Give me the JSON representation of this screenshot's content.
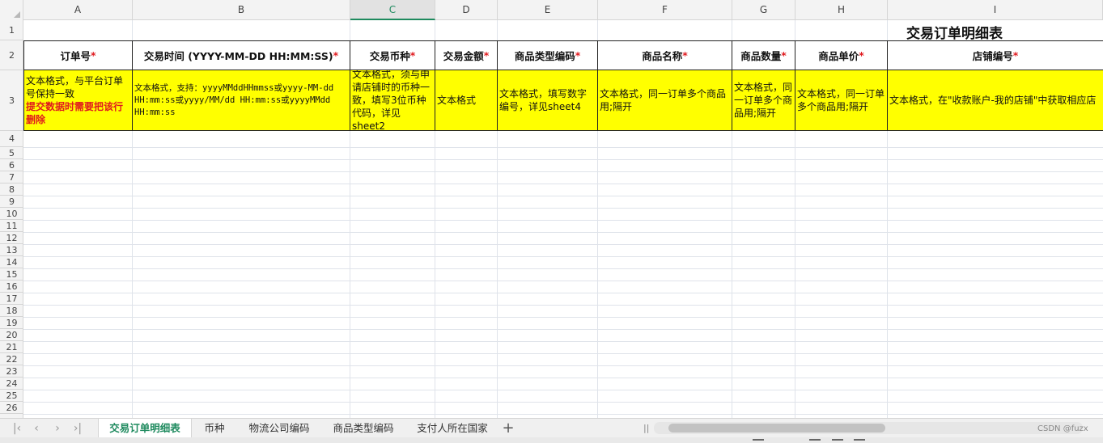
{
  "column_headers": [
    "A",
    "B",
    "C",
    "D",
    "E",
    "F",
    "G",
    "H",
    "I"
  ],
  "row_numbers": [
    "1",
    "2",
    "3",
    "4",
    "5",
    "6",
    "7",
    "8",
    "9",
    "10",
    "11",
    "12",
    "13",
    "14",
    "15",
    "16",
    "17",
    "18",
    "19",
    "20",
    "21",
    "22",
    "23",
    "24",
    "25",
    "26"
  ],
  "sheet": {
    "title": "交易订单明细表",
    "headers": [
      {
        "label": "订单号",
        "star": "*"
      },
      {
        "label": "交易时间 (YYYY-MM-DD HH:MM:SS)",
        "star": " *"
      },
      {
        "label": "交易币种",
        "star": "*"
      },
      {
        "label": "交易金额",
        "star": "*"
      },
      {
        "label": "商品类型编码",
        "star": "*"
      },
      {
        "label": "商品名称",
        "star": "*"
      },
      {
        "label": "商品数量",
        "star": "*"
      },
      {
        "label": "商品单价",
        "star": "*"
      },
      {
        "label": "店铺编号",
        "star": "*"
      }
    ],
    "descriptions": {
      "a": "文本格式，与平台订单号保持一致",
      "a_warning": "提交数据时需要把该行删除",
      "b": "文本格式，支持：yyyyMMddHHmmss或yyyy-MM-dd HH:mm:ss或yyyy/MM/dd HH:mm:ss或yyyyMMdd HH:mm:ss",
      "c": "文本格式，须与申请店铺时的币种一致，填写3位币种代码，详见sheet2",
      "d": "文本格式",
      "e": "文本格式，填写数字编号，详见sheet4",
      "f": "文本格式，同一订单多个商品用;隔开",
      "g": "文本格式，同一订单多个商品用;隔开",
      "h": "文本格式，同一订单多个商品用;隔开",
      "i": "文本格式，在\"收款账户-我的店铺\"中获取相应店"
    }
  },
  "tabs": [
    "交易订单明细表",
    "币种",
    "物流公司编码",
    "商品类型编码",
    "支付人所在国家"
  ],
  "active_tab": 0,
  "watermark": "CSDN @fuzx",
  "colors": {
    "highlight": "#ffff00",
    "required_star": "#e0191e",
    "accent": "#1e8a5e"
  }
}
